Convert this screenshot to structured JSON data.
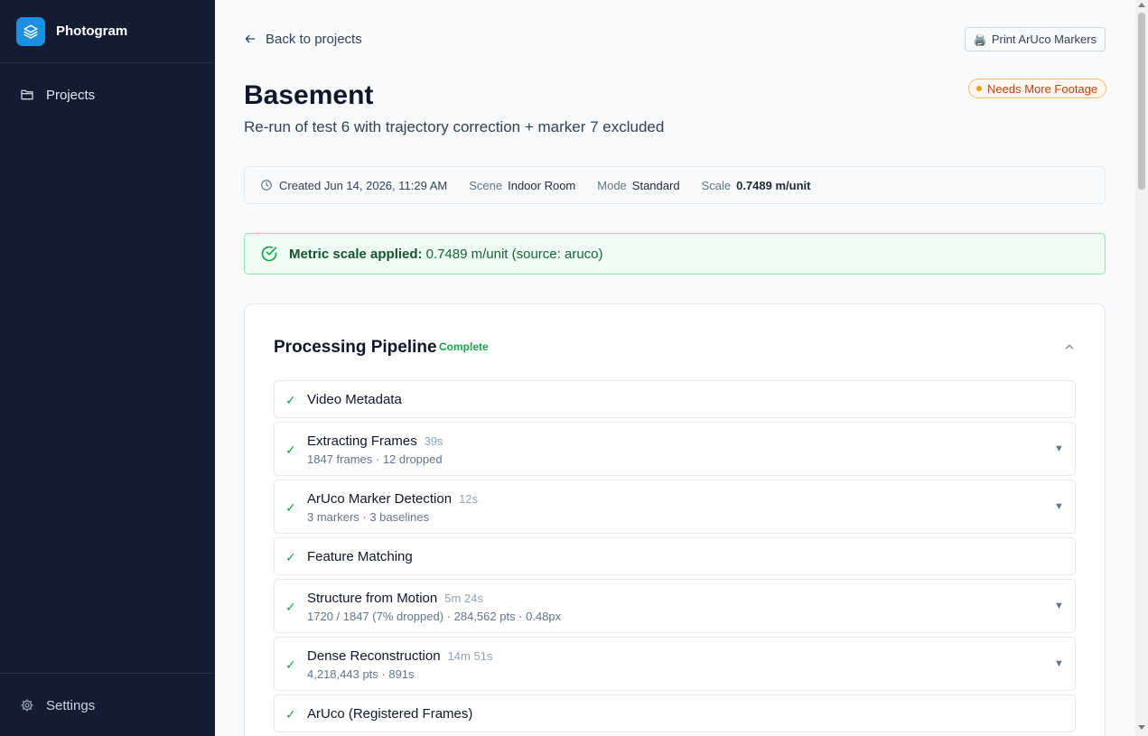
{
  "app": {
    "name": "Photogram"
  },
  "sidebar": {
    "items": [
      {
        "label": "Projects",
        "icon": "folder-icon"
      }
    ],
    "footer": {
      "label": "Settings",
      "icon": "gear-icon"
    }
  },
  "header": {
    "back_label": "Back to projects",
    "print_label": "Print ArUco Markers",
    "print_glyph": "🖨️",
    "title": "Basement",
    "subtitle": "Re-run of test 6 with trajectory correction + marker 7 excluded",
    "status": "Needs More Footage"
  },
  "meta": {
    "created": "Created Jun 14, 2026, 11:29 AM",
    "scene_label": "Scene",
    "scene_value": "Indoor Room",
    "mode_label": "Mode",
    "mode_value": "Standard",
    "scale_label": "Scale",
    "scale_value": "0.7489 m/unit"
  },
  "scale_banner": {
    "label": "Metric scale applied:",
    "text": "0.7489 m/unit (source: aruco)"
  },
  "pipeline": {
    "title": "Processing Pipeline",
    "status": "Complete",
    "check_glyph": "✓",
    "expand_glyph": "▼",
    "steps": [
      {
        "name": "Video Metadata",
        "duration": "",
        "detail": ""
      },
      {
        "name": "Extracting Frames",
        "duration": "39s",
        "detail": "1847 frames · 12 dropped"
      },
      {
        "name": "ArUco Marker Detection",
        "duration": "12s",
        "detail": "3 markers · 3 baselines"
      },
      {
        "name": "Feature Matching",
        "duration": "",
        "detail": ""
      },
      {
        "name": "Structure from Motion",
        "duration": "5m 24s",
        "detail": "1720 / 1847 (7% dropped) · 284,562 pts · 0.48px"
      },
      {
        "name": "Dense Reconstruction",
        "duration": "14m 51s",
        "detail": "4,218,443 pts · 891s"
      },
      {
        "name": "ArUco (Registered Frames)",
        "duration": "",
        "detail": ""
      }
    ]
  },
  "colors": {
    "sidebar_bg": "#131c31",
    "brand_accent": "#1d8fe0",
    "success": "#16a34a",
    "warning": "#c2410c"
  }
}
